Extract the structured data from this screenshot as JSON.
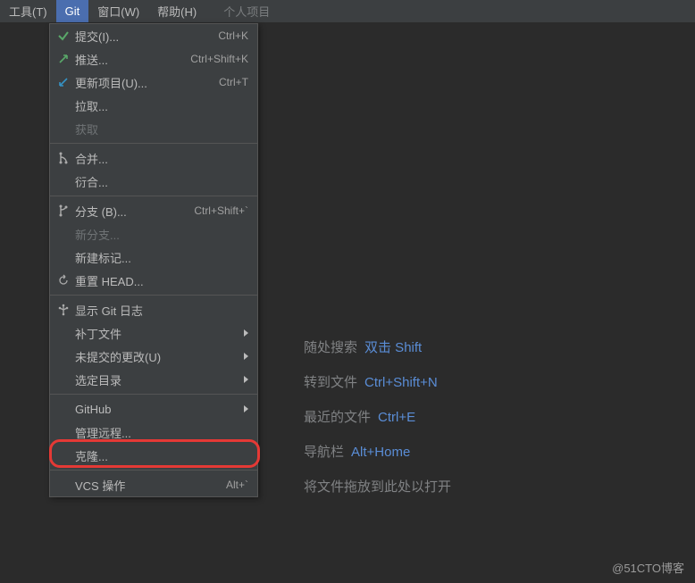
{
  "menubar": {
    "tools": "工具(T)",
    "git": "Git",
    "window": "窗口(W)",
    "help": "帮助(H)",
    "project": "个人项目"
  },
  "dropdown": {
    "commit": {
      "label": "提交(I)...",
      "shortcut": "Ctrl+K"
    },
    "push": {
      "label": "推送...",
      "shortcut": "Ctrl+Shift+K"
    },
    "update": {
      "label": "更新项目(U)...",
      "shortcut": "Ctrl+T"
    },
    "pull": {
      "label": "拉取..."
    },
    "fetch": {
      "label": "获取"
    },
    "merge": {
      "label": "合并..."
    },
    "rebase": {
      "label": "衍合..."
    },
    "branches": {
      "label": "分支 (B)...",
      "shortcut": "Ctrl+Shift+`"
    },
    "newbranch": {
      "label": "新分支..."
    },
    "newtag": {
      "label": "新建标记..."
    },
    "resethead": {
      "label": "重置 HEAD..."
    },
    "showlog": {
      "label": "显示 Git 日志"
    },
    "patches": {
      "label": "补丁文件"
    },
    "uncommitted": {
      "label": "未提交的更改(U)"
    },
    "selectdir": {
      "label": "选定目录"
    },
    "github": {
      "label": "GitHub"
    },
    "remotes": {
      "label": "管理远程..."
    },
    "clone": {
      "label": "克隆..."
    },
    "vcsops": {
      "label": "VCS 操作",
      "shortcut": "Alt+`"
    }
  },
  "welcome": {
    "search": {
      "label": "随处搜索",
      "key": "双击 Shift"
    },
    "gotofile": {
      "label": "转到文件",
      "key": "Ctrl+Shift+N"
    },
    "recent": {
      "label": "最近的文件",
      "key": "Ctrl+E"
    },
    "navbar": {
      "label": "导航栏",
      "key": "Alt+Home"
    },
    "drop": {
      "label": "将文件拖放到此处以打开"
    }
  },
  "watermark": "@51CTO博客"
}
